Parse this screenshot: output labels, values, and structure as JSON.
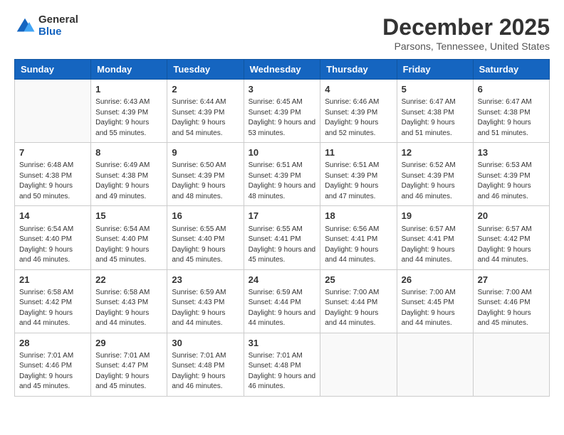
{
  "header": {
    "logo": {
      "general": "General",
      "blue": "Blue"
    },
    "title": "December 2025",
    "subtitle": "Parsons, Tennessee, United States"
  },
  "columns": [
    "Sunday",
    "Monday",
    "Tuesday",
    "Wednesday",
    "Thursday",
    "Friday",
    "Saturday"
  ],
  "weeks": [
    [
      {
        "day": "",
        "sunrise": "",
        "sunset": "",
        "daylight": ""
      },
      {
        "day": "1",
        "sunrise": "Sunrise: 6:43 AM",
        "sunset": "Sunset: 4:39 PM",
        "daylight": "Daylight: 9 hours and 55 minutes."
      },
      {
        "day": "2",
        "sunrise": "Sunrise: 6:44 AM",
        "sunset": "Sunset: 4:39 PM",
        "daylight": "Daylight: 9 hours and 54 minutes."
      },
      {
        "day": "3",
        "sunrise": "Sunrise: 6:45 AM",
        "sunset": "Sunset: 4:39 PM",
        "daylight": "Daylight: 9 hours and 53 minutes."
      },
      {
        "day": "4",
        "sunrise": "Sunrise: 6:46 AM",
        "sunset": "Sunset: 4:39 PM",
        "daylight": "Daylight: 9 hours and 52 minutes."
      },
      {
        "day": "5",
        "sunrise": "Sunrise: 6:47 AM",
        "sunset": "Sunset: 4:38 PM",
        "daylight": "Daylight: 9 hours and 51 minutes."
      },
      {
        "day": "6",
        "sunrise": "Sunrise: 6:47 AM",
        "sunset": "Sunset: 4:38 PM",
        "daylight": "Daylight: 9 hours and 51 minutes."
      }
    ],
    [
      {
        "day": "7",
        "sunrise": "Sunrise: 6:48 AM",
        "sunset": "Sunset: 4:38 PM",
        "daylight": "Daylight: 9 hours and 50 minutes."
      },
      {
        "day": "8",
        "sunrise": "Sunrise: 6:49 AM",
        "sunset": "Sunset: 4:38 PM",
        "daylight": "Daylight: 9 hours and 49 minutes."
      },
      {
        "day": "9",
        "sunrise": "Sunrise: 6:50 AM",
        "sunset": "Sunset: 4:39 PM",
        "daylight": "Daylight: 9 hours and 48 minutes."
      },
      {
        "day": "10",
        "sunrise": "Sunrise: 6:51 AM",
        "sunset": "Sunset: 4:39 PM",
        "daylight": "Daylight: 9 hours and 48 minutes."
      },
      {
        "day": "11",
        "sunrise": "Sunrise: 6:51 AM",
        "sunset": "Sunset: 4:39 PM",
        "daylight": "Daylight: 9 hours and 47 minutes."
      },
      {
        "day": "12",
        "sunrise": "Sunrise: 6:52 AM",
        "sunset": "Sunset: 4:39 PM",
        "daylight": "Daylight: 9 hours and 46 minutes."
      },
      {
        "day": "13",
        "sunrise": "Sunrise: 6:53 AM",
        "sunset": "Sunset: 4:39 PM",
        "daylight": "Daylight: 9 hours and 46 minutes."
      }
    ],
    [
      {
        "day": "14",
        "sunrise": "Sunrise: 6:54 AM",
        "sunset": "Sunset: 4:40 PM",
        "daylight": "Daylight: 9 hours and 46 minutes."
      },
      {
        "day": "15",
        "sunrise": "Sunrise: 6:54 AM",
        "sunset": "Sunset: 4:40 PM",
        "daylight": "Daylight: 9 hours and 45 minutes."
      },
      {
        "day": "16",
        "sunrise": "Sunrise: 6:55 AM",
        "sunset": "Sunset: 4:40 PM",
        "daylight": "Daylight: 9 hours and 45 minutes."
      },
      {
        "day": "17",
        "sunrise": "Sunrise: 6:55 AM",
        "sunset": "Sunset: 4:41 PM",
        "daylight": "Daylight: 9 hours and 45 minutes."
      },
      {
        "day": "18",
        "sunrise": "Sunrise: 6:56 AM",
        "sunset": "Sunset: 4:41 PM",
        "daylight": "Daylight: 9 hours and 44 minutes."
      },
      {
        "day": "19",
        "sunrise": "Sunrise: 6:57 AM",
        "sunset": "Sunset: 4:41 PM",
        "daylight": "Daylight: 9 hours and 44 minutes."
      },
      {
        "day": "20",
        "sunrise": "Sunrise: 6:57 AM",
        "sunset": "Sunset: 4:42 PM",
        "daylight": "Daylight: 9 hours and 44 minutes."
      }
    ],
    [
      {
        "day": "21",
        "sunrise": "Sunrise: 6:58 AM",
        "sunset": "Sunset: 4:42 PM",
        "daylight": "Daylight: 9 hours and 44 minutes."
      },
      {
        "day": "22",
        "sunrise": "Sunrise: 6:58 AM",
        "sunset": "Sunset: 4:43 PM",
        "daylight": "Daylight: 9 hours and 44 minutes."
      },
      {
        "day": "23",
        "sunrise": "Sunrise: 6:59 AM",
        "sunset": "Sunset: 4:43 PM",
        "daylight": "Daylight: 9 hours and 44 minutes."
      },
      {
        "day": "24",
        "sunrise": "Sunrise: 6:59 AM",
        "sunset": "Sunset: 4:44 PM",
        "daylight": "Daylight: 9 hours and 44 minutes."
      },
      {
        "day": "25",
        "sunrise": "Sunrise: 7:00 AM",
        "sunset": "Sunset: 4:44 PM",
        "daylight": "Daylight: 9 hours and 44 minutes."
      },
      {
        "day": "26",
        "sunrise": "Sunrise: 7:00 AM",
        "sunset": "Sunset: 4:45 PM",
        "daylight": "Daylight: 9 hours and 44 minutes."
      },
      {
        "day": "27",
        "sunrise": "Sunrise: 7:00 AM",
        "sunset": "Sunset: 4:46 PM",
        "daylight": "Daylight: 9 hours and 45 minutes."
      }
    ],
    [
      {
        "day": "28",
        "sunrise": "Sunrise: 7:01 AM",
        "sunset": "Sunset: 4:46 PM",
        "daylight": "Daylight: 9 hours and 45 minutes."
      },
      {
        "day": "29",
        "sunrise": "Sunrise: 7:01 AM",
        "sunset": "Sunset: 4:47 PM",
        "daylight": "Daylight: 9 hours and 45 minutes."
      },
      {
        "day": "30",
        "sunrise": "Sunrise: 7:01 AM",
        "sunset": "Sunset: 4:48 PM",
        "daylight": "Daylight: 9 hours and 46 minutes."
      },
      {
        "day": "31",
        "sunrise": "Sunrise: 7:01 AM",
        "sunset": "Sunset: 4:48 PM",
        "daylight": "Daylight: 9 hours and 46 minutes."
      },
      {
        "day": "",
        "sunrise": "",
        "sunset": "",
        "daylight": ""
      },
      {
        "day": "",
        "sunrise": "",
        "sunset": "",
        "daylight": ""
      },
      {
        "day": "",
        "sunrise": "",
        "sunset": "",
        "daylight": ""
      }
    ]
  ]
}
